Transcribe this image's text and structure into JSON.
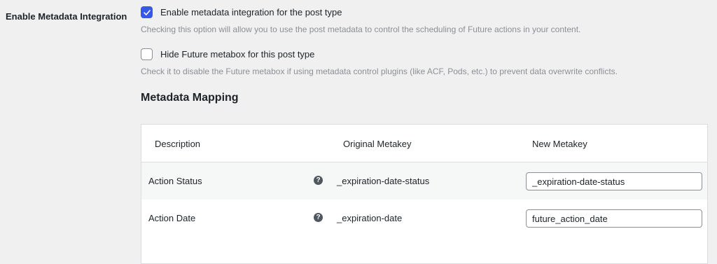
{
  "section_label": "Enable Metadata Integration",
  "options": {
    "enable": {
      "label": "Enable metadata integration for the post type",
      "checked": true,
      "description": "Checking this option will allow you to use the post metadata to control the scheduling of Future actions in your content."
    },
    "hide_metabox": {
      "label": "Hide Future metabox for this post type",
      "checked": false,
      "description": "Check it to disable the Future metabox if using metadata control plugins (like ACF, Pods, etc.) to prevent data overwrite conflicts."
    }
  },
  "mapping": {
    "title": "Metadata Mapping",
    "headers": {
      "description": "Description",
      "original": "Original Metakey",
      "new": "New Metakey"
    },
    "rows": [
      {
        "description": "Action Status",
        "help_icon": "question-circle-icon",
        "original": "_expiration-date-status",
        "new_value": "_expiration-date-status"
      },
      {
        "description": "Action Date",
        "help_icon": "question-circle-icon",
        "original": "_expiration-date",
        "new_value": "future_action_date"
      }
    ]
  },
  "colors": {
    "accent": "#3858e9",
    "background": "#f0f0f1",
    "muted_text": "#8c8f94"
  }
}
